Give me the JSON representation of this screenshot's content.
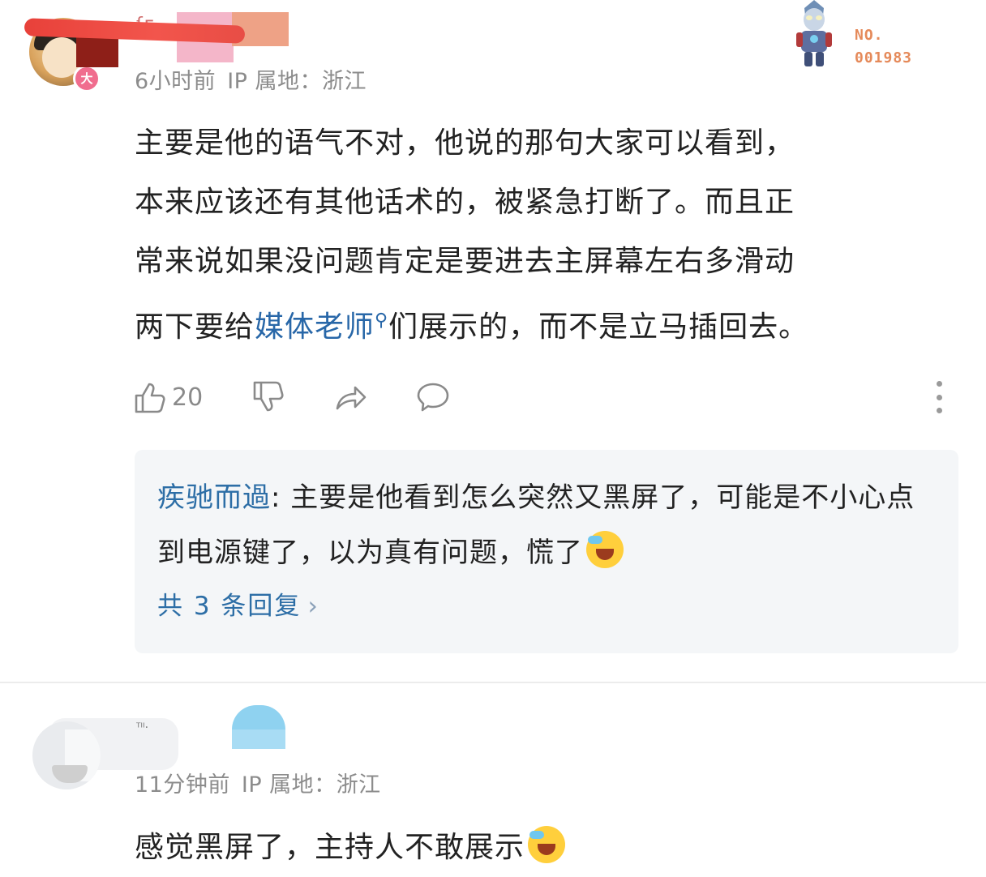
{
  "comment1": {
    "meta": {
      "time": "6小时前",
      "ip_label": "IP 属地：",
      "ip_value": "浙江"
    },
    "badge": "大",
    "text_line1": "主要是他的语气不对，他说的那句大家可以看到，",
    "text_line2": "本来应该还有其他话术的，被紧急打断了。而且正",
    "text_line3": "常来说如果没问题肯定是要进去主屏幕左右多滑动",
    "text_line4_pre": "两下要给",
    "text_line4_link": "媒体老师",
    "text_line4_post": "们展示的，而不是立马插回去。",
    "like_count": "20",
    "reply": {
      "user": "疾驰而過",
      "separator": ": ",
      "text": "主要是他看到怎么突然又黑屏了，可能是不小心点到电源键了，以为真有问题，慌了",
      "count_label": "共 3 条回复",
      "chevron": "›"
    }
  },
  "comment2": {
    "meta": {
      "time": "11分钟前",
      "ip_label": "IP 属地：",
      "ip_value": "浙江"
    },
    "text": "感觉黑屏了，主持人不敢展示"
  },
  "sticker": {
    "line1": "NO.",
    "line2": "001983"
  },
  "colors": {
    "link": "#2867a8",
    "reply_user": "#2d6ea6",
    "meta": "#8c8c8c"
  }
}
